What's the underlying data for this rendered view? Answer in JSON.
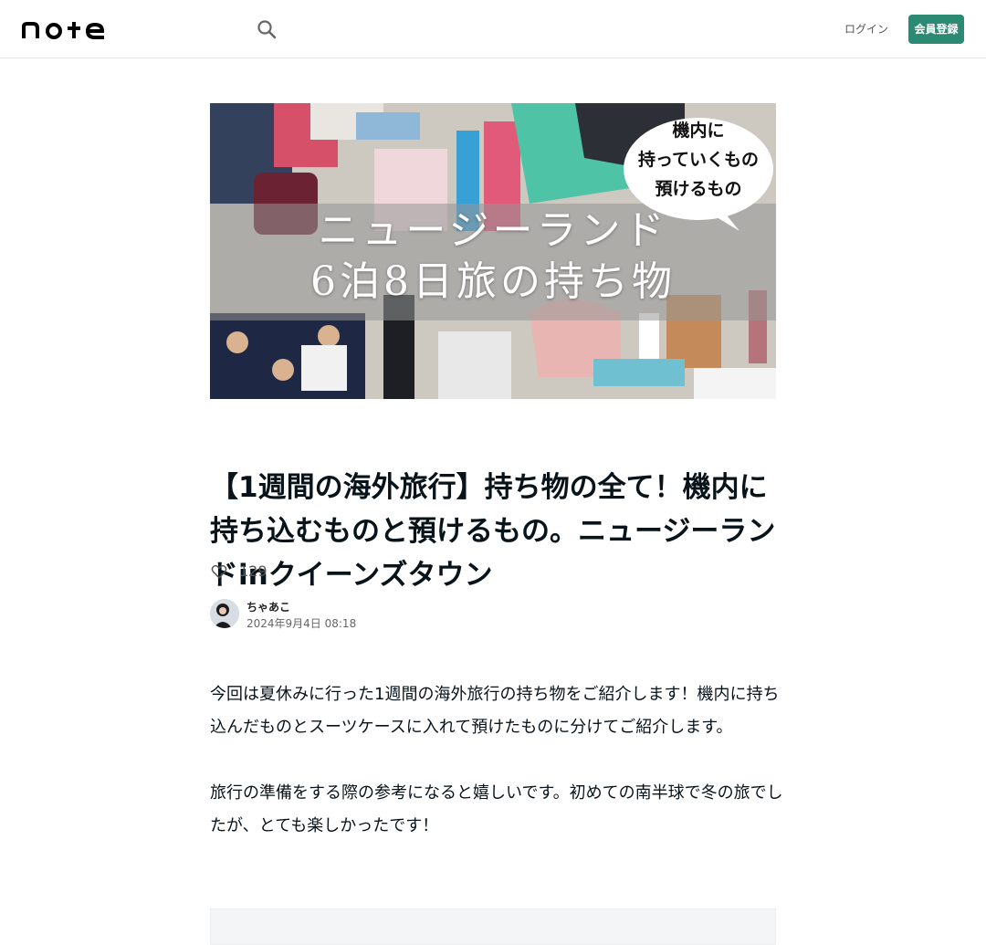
{
  "header": {
    "logo_text": "note",
    "login_label": "ログイン",
    "signup_label": "会員登録"
  },
  "hero": {
    "headline_line1": "ニュージーランド",
    "headline_line2": "6泊8日旅の持ち物",
    "bubble_line1": "機内に",
    "bubble_line2": "持っていくもの",
    "bubble_line3": "預けるもの"
  },
  "article": {
    "title": "【1週間の海外旅行】持ち物の全て！機内に持ち込むものと預けるもの。ニュージーランドinクイーンズタウン",
    "like_count": "129",
    "author_name": "ちゃあこ",
    "date": "2024年9月4日 08:18",
    "paragraphs": [
      "今回は夏休みに行った1週間の海外旅行の持ち物をご紹介します！機内に持ち込んだものとスーツケースに入れて預けたものに分けてご紹介します。",
      "旅行の準備をする際の参考になると嬉しいです。初めての南半球で冬の旅でしたが、とても楽しかったです！"
    ]
  },
  "colors": {
    "accent": "#2a8a73",
    "text": "#08131a"
  }
}
